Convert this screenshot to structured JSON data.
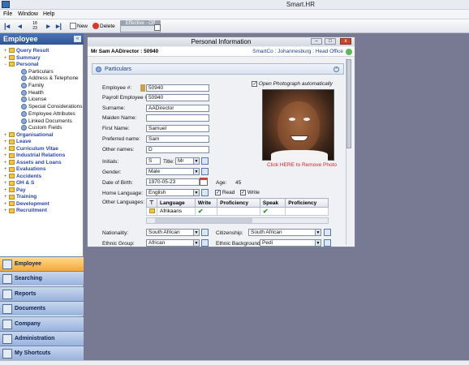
{
  "app": {
    "title": "Smart.HR"
  },
  "menu": [
    "File",
    "Window",
    "Help"
  ],
  "toolbar": {
    "page": "18\n23",
    "new_label": "New",
    "delete_label": "Delete",
    "effective_label": "Effective",
    "effective_value": "Off"
  },
  "sidebar": {
    "title": "Employee",
    "items": [
      {
        "type": "cat",
        "label": "Query Result"
      },
      {
        "type": "cat",
        "label": "Summary"
      },
      {
        "type": "cat",
        "label": "Personal",
        "expanded": true
      },
      {
        "type": "sub",
        "label": "Particulars"
      },
      {
        "type": "sub",
        "label": "Address & Telephone"
      },
      {
        "type": "sub",
        "label": "Family"
      },
      {
        "type": "sub",
        "label": "Health"
      },
      {
        "type": "sub",
        "label": "License"
      },
      {
        "type": "sub",
        "label": "Special Considerations"
      },
      {
        "type": "sub",
        "label": "Employee Attributes"
      },
      {
        "type": "sub",
        "label": "Linked Documents"
      },
      {
        "type": "sub",
        "label": "Custom Fields"
      },
      {
        "type": "cat",
        "label": "Organisational"
      },
      {
        "type": "cat",
        "label": "Leave"
      },
      {
        "type": "cat",
        "label": "Curriculum Vitae"
      },
      {
        "type": "cat",
        "label": "Industrial Relations"
      },
      {
        "type": "cat",
        "label": "Assets and Loans"
      },
      {
        "type": "cat",
        "label": "Evaluations"
      },
      {
        "type": "cat",
        "label": "Accidents"
      },
      {
        "type": "cat",
        "label": "OH & S"
      },
      {
        "type": "cat",
        "label": "Pay"
      },
      {
        "type": "cat",
        "label": "Training"
      },
      {
        "type": "cat",
        "label": "Development"
      },
      {
        "type": "cat",
        "label": "Recruitment"
      }
    ],
    "nav": [
      "Employee",
      "Searching",
      "Reports",
      "Documents",
      "Company",
      "Administration",
      "My Shortcuts"
    ]
  },
  "window": {
    "title": "Personal Information",
    "employee": "Mr Sam AADirector  :  50940",
    "location": "SmartCo : Johannesburg : Head Office",
    "section": "Particulars"
  },
  "form": {
    "employee_no_label": "Employee #:",
    "employee_no": "50940",
    "payroll_label": "Payroll Employee #:",
    "payroll": "50940",
    "surname_label": "Surname:",
    "surname": "AADirector",
    "maiden_label": "Maiden Name:",
    "maiden": "",
    "first_label": "First Name:",
    "first": "Samuel",
    "preferred_label": "Preferred name:",
    "preferred": "Sam",
    "other_label": "Other names:",
    "other": "D",
    "initials_label": "Initials:",
    "initials": "S",
    "title_label": "Title:",
    "title": "Mr",
    "gender_label": "Gender:",
    "gender": "Male",
    "dob_label": "Date of Birth:",
    "dob": "1970-05-23",
    "age_label": "Age:",
    "age": "45",
    "home_lang_label": "Home Language:",
    "home_lang": "English",
    "read_label": "Read",
    "write_label": "Write",
    "other_lang_label": "Other Languages:",
    "nationality_label": "Nationality:",
    "nationality": "South African",
    "citizenship_label": "Citizenship:",
    "citizenship": "South African",
    "ethnic_group_label": "Ethnic Group:",
    "ethnic_group": "African",
    "ethnic_bg_label": "Ethnic Background:",
    "ethnic_bg": "Pedi",
    "open_photo_label": "Open Photograph automatically",
    "remove_photo": "Click HERE to Remove Photo"
  },
  "languages": {
    "headers": [
      "Language",
      "Write",
      "Proficiency",
      "Speak",
      "Proficiency"
    ],
    "rows": [
      {
        "language": "Afrikaans",
        "write": true,
        "speak": true
      }
    ]
  }
}
